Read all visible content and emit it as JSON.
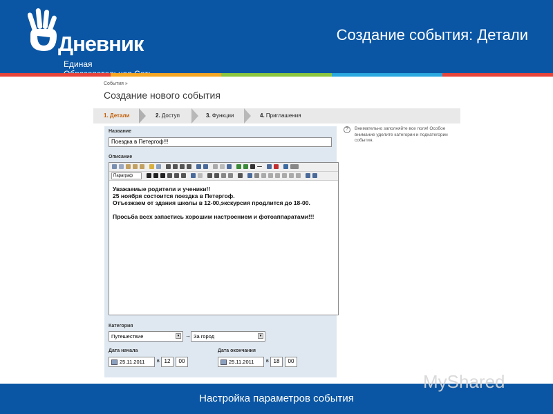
{
  "header": {
    "logo_word": "Дневник",
    "logo_tagline": "Единая Образовательная Сеть",
    "slide_title": "Создание события: Детали"
  },
  "stripe_colors": [
    "#e8443a",
    "#f5a623",
    "#8cc63f",
    "#2aa8e0",
    "#e8443a"
  ],
  "page": {
    "breadcrumb": "События »",
    "title": "Создание нового события",
    "steps": [
      {
        "num": "1.",
        "label": "Детали"
      },
      {
        "num": "2.",
        "label": "Доступ"
      },
      {
        "num": "3.",
        "label": "Функции"
      },
      {
        "num": "4.",
        "label": "Приглашения"
      }
    ]
  },
  "form": {
    "name_label": "Название",
    "name_value": "Поездка в Петергоф!!!",
    "description_label": "Описание",
    "format_select": "Параграф",
    "editor_lines": [
      "Уважаемые родители и ученики!!",
      "25 ноября состоится поездка в Петергоф.",
      "Отъезжаем от здания школы в 12-00,экскурсия продлится до 18-00.",
      "",
      "Просьба всех запастись хорошим настроением и фотоаппаратами!!!"
    ],
    "category_label": "Категория",
    "category_value": "Путешествие",
    "category_arrow": "→",
    "subcategory_value": "За город",
    "start_label": "Дата начала",
    "start_date": "25.11.2011",
    "start_at": "в",
    "start_hour": "12",
    "start_min": "00",
    "end_label": "Дата окончания",
    "end_date": "25.11.2011",
    "end_at": "в",
    "end_hour": "18",
    "end_min": "00"
  },
  "help": {
    "icon": "?",
    "text": "Внимательно заполняйте все поля! Особое внимание уделите категории и подкатегории события."
  },
  "footer": {
    "text": "Настройка параметров события"
  },
  "watermark": "MyShared"
}
